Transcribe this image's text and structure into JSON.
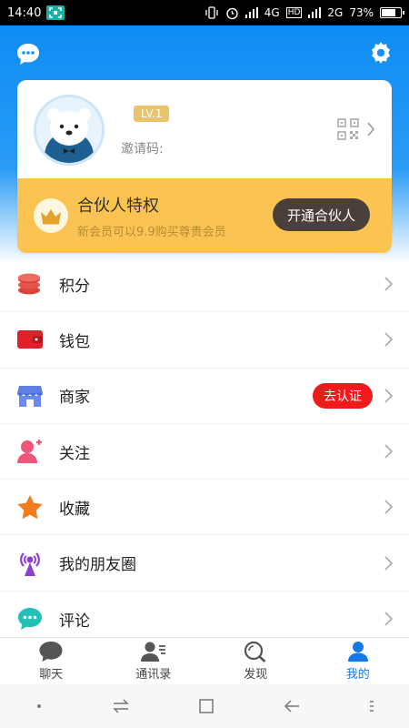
{
  "status_bar": {
    "time": "14:40",
    "network_1": "4G",
    "hd": "HD",
    "network_2": "2G",
    "battery": "73%",
    "battery_level": 0.73
  },
  "profile": {
    "level": "LV.1",
    "invite_label": "邀请码:"
  },
  "partner": {
    "title": "合伙人特权",
    "subtitle": "新会员可以9.9购买尊贵会员",
    "button": "开通合伙人"
  },
  "menu": [
    {
      "label": "积分",
      "icon": "coins-icon"
    },
    {
      "label": "钱包",
      "icon": "wallet-icon"
    },
    {
      "label": "商家",
      "icon": "store-icon",
      "badge": "去认证"
    },
    {
      "label": "关注",
      "icon": "follow-user-icon"
    },
    {
      "label": "收藏",
      "icon": "star-icon"
    },
    {
      "label": "我的朋友圈",
      "icon": "broadcast-icon"
    },
    {
      "label": "评论",
      "icon": "comment-icon"
    }
  ],
  "tabs": [
    {
      "label": "聊天",
      "icon": "chat-bubble-icon"
    },
    {
      "label": "通讯录",
      "icon": "contacts-icon"
    },
    {
      "label": "发现",
      "icon": "discover-icon"
    },
    {
      "label": "我的",
      "icon": "me-icon",
      "active": true
    }
  ],
  "colors": {
    "primary": "#0e8cf4",
    "accent_gold": "#fbc452",
    "badge_red": "#f01a1a",
    "active_tab": "#1479e8"
  }
}
